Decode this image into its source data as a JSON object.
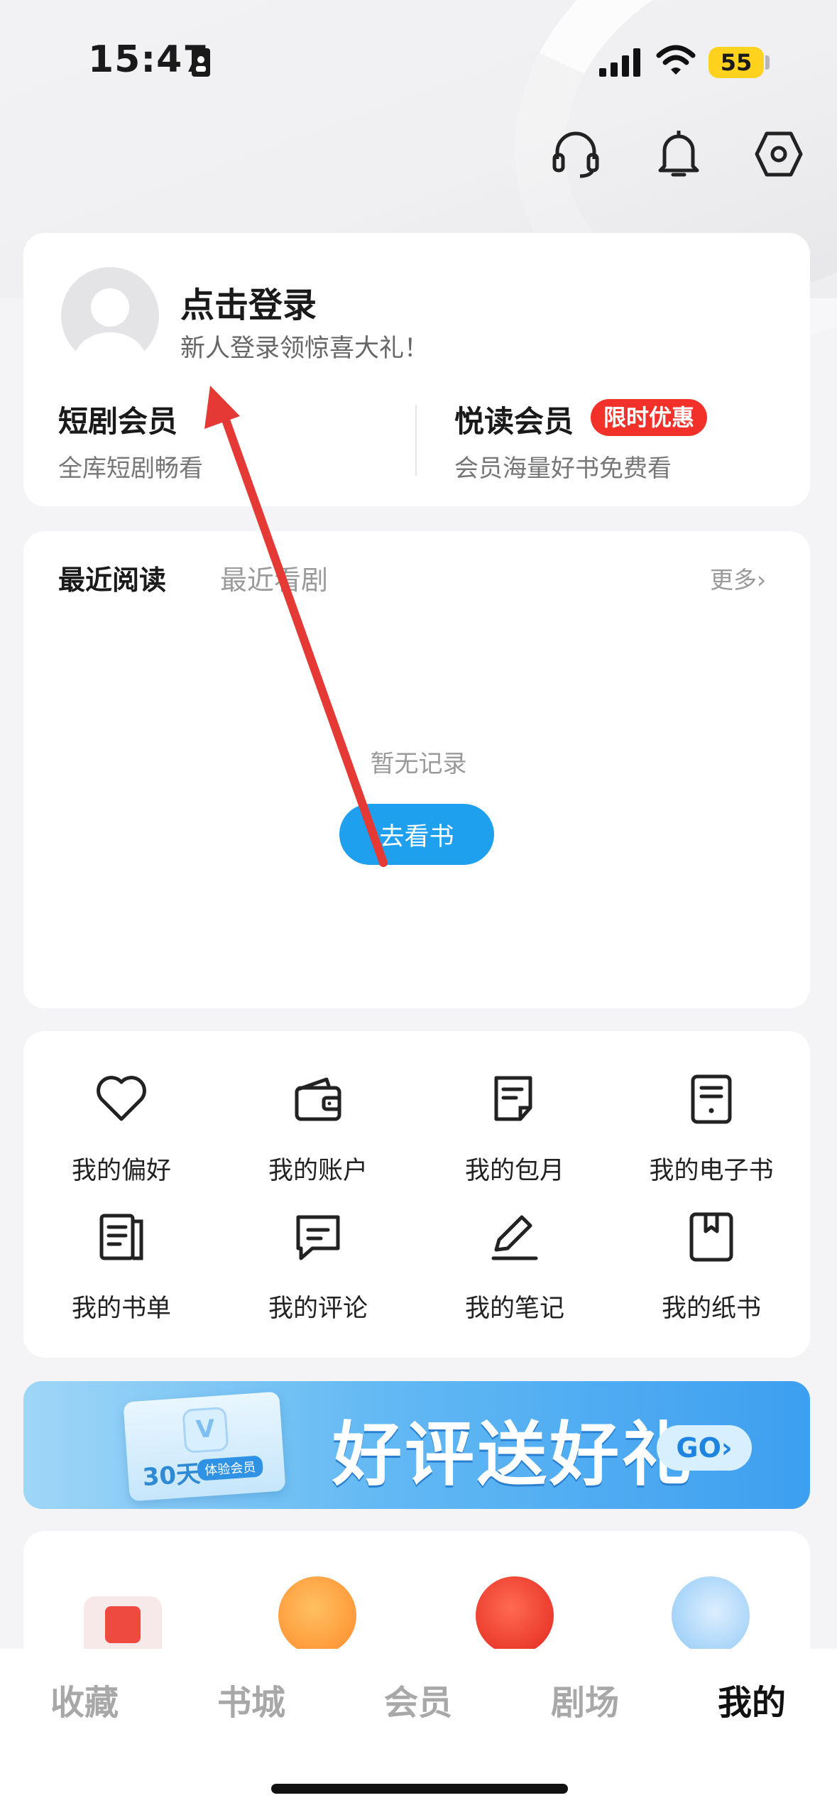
{
  "status_bar": {
    "time": "15:47",
    "battery": "55"
  },
  "login": {
    "title": "点击登录",
    "subtitle": "新人登录领惊喜大礼！"
  },
  "membership": {
    "drama": {
      "title": "短剧会员",
      "subtitle": "全库短剧畅看"
    },
    "reading": {
      "title": "悦读会员",
      "badge": "限时优惠",
      "subtitle": "会员海量好书免费看"
    }
  },
  "recent": {
    "tabs": [
      "最近阅读",
      "最近看剧"
    ],
    "more": "更多",
    "empty_text": "暂无记录",
    "action": "去看书"
  },
  "services": [
    {
      "label": "我的偏好",
      "icon": "heart-icon"
    },
    {
      "label": "我的账户",
      "icon": "wallet-icon"
    },
    {
      "label": "我的包月",
      "icon": "subscription-doc-icon"
    },
    {
      "label": "我的电子书",
      "icon": "ebook-icon"
    },
    {
      "label": "我的书单",
      "icon": "booklist-icon"
    },
    {
      "label": "我的评论",
      "icon": "comment-icon"
    },
    {
      "label": "我的笔记",
      "icon": "pen-icon"
    },
    {
      "label": "我的纸书",
      "icon": "paper-book-icon"
    }
  ],
  "banner": {
    "title": "好评送好礼",
    "go": "GO",
    "ticket_days": "30天",
    "ticket_tag": "体验会员"
  },
  "tabbar": [
    "收藏",
    "书城",
    "会员",
    "剧场",
    "我的"
  ],
  "tabbar_active": "我的",
  "colors": {
    "accent": "#1ea0ee",
    "badge": "#f2322a",
    "annotation_arrow": "#e53935"
  }
}
